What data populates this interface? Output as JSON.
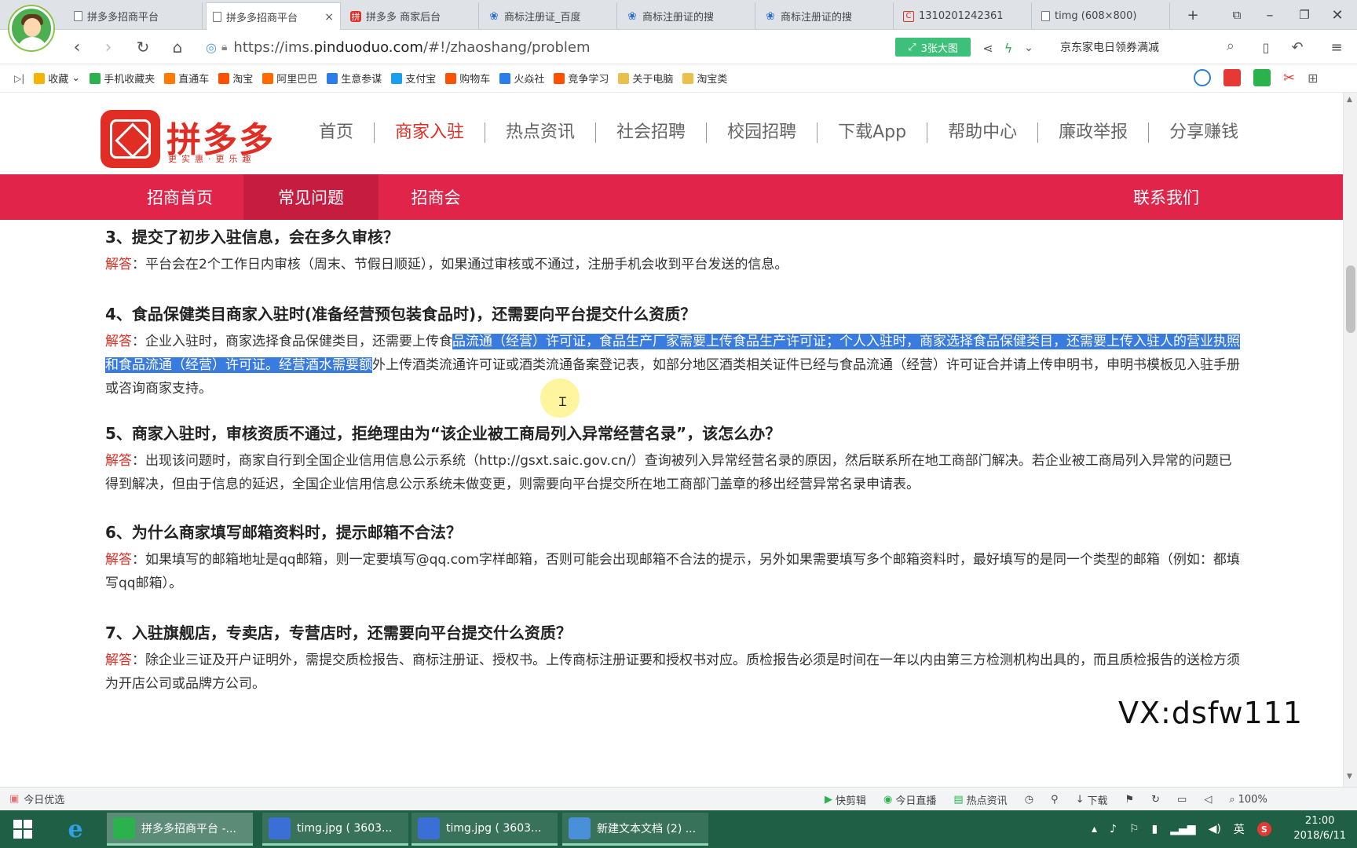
{
  "browser": {
    "tabs": [
      {
        "label": "拼多多招商平台",
        "icon": "doc-icon",
        "active": false
      },
      {
        "label": "拼多多招商平台",
        "icon": "doc-icon",
        "active": true
      },
      {
        "label": "拼多多 商家后台",
        "icon": "pdd-icon",
        "active": false
      },
      {
        "label": "商标注册证_百度",
        "icon": "paw-icon",
        "active": false
      },
      {
        "label": "商标注册证的搜",
        "icon": "paw-icon",
        "active": false
      },
      {
        "label": "商标注册证的搜",
        "icon": "paw-icon",
        "active": false
      },
      {
        "label": "1310201242361",
        "icon": "c-icon",
        "active": false
      },
      {
        "label": "timg (608×800)",
        "icon": "doc-icon",
        "active": false
      }
    ],
    "new_tab": "+",
    "close_glyph": "×",
    "url_prefix": "https://ims.",
    "url_host": "pinduoduo.com",
    "url_path": "/#!/zhaoshang/problem",
    "bigimg_label": "3张大图",
    "search_text": "京东家电日领券满减",
    "bookmarks": [
      {
        "label": "收藏",
        "color": "#f5b400"
      },
      {
        "label": "手机收藏夹",
        "color": "#2bb24c"
      },
      {
        "label": "直通车",
        "color": "#ff7a00"
      },
      {
        "label": "淘宝",
        "color": "#ff5000"
      },
      {
        "label": "阿里巴巴",
        "color": "#ff6a00"
      },
      {
        "label": "生意参谋",
        "color": "#2b7de9"
      },
      {
        "label": "支付宝",
        "color": "#1a9ff0"
      },
      {
        "label": "购物车",
        "color": "#ff5000"
      },
      {
        "label": "火焱社",
        "color": "#2b7de9"
      },
      {
        "label": "竞争学习",
        "color": "#ff5000"
      },
      {
        "label": "关于电脑",
        "color": "#e8c04a"
      },
      {
        "label": "淘宝类",
        "color": "#e8c04a"
      }
    ]
  },
  "site": {
    "logo_name": "拼多多",
    "slogan": "更实惠·更乐趣",
    "top_nav": [
      "首页",
      "商家入驻",
      "热点资讯",
      "社会招聘",
      "校园招聘",
      "下载App",
      "帮助中心",
      "廉政举报",
      "分享赚钱"
    ],
    "top_nav_active": 1,
    "sub_nav": [
      "招商首页",
      "常见问题",
      "招商会"
    ],
    "sub_nav_active": 1,
    "contact": "联系我们"
  },
  "faq": [
    {
      "q": "3、提交了初步入驻信息，会在多久审核？",
      "label": "解答",
      "a": "：平台会在2个工作日内审核（周末、节假日顺延），如果通过审核或不通过，注册手机会收到平台发送的信息。"
    },
    {
      "q": "4、食品保健类目商家入驻时(准备经营预包装食品时)，还需要向平台提交什么资质？",
      "label": "解答",
      "a_pre": "：企业入驻时，商家选择食品保健类目，还需要上传食",
      "a_hl": "品流通（经营）许可证，食品生产厂家需要上传食品生产许可证；个人入驻时，商家选择食品保健类目，还需要上传入驻人的营业执照和食品流通（经营）许可证。经营酒水需要额",
      "a_post": "外上传酒类流通许可证或酒类流通备案登记表，如部分地区酒类相关证件已经与食品流通（经营）许可证合并请上传申明书，申明书模板见入驻手册或咨询商家支持。"
    },
    {
      "q": "5、商家入驻时，审核资质不通过，拒绝理由为“该企业被工商局列入异常经营名录”，该怎么办？",
      "label": "解答",
      "a": "：出现该问题时，商家自行到全国企业信用信息公示系统（http://gsxt.saic.gov.cn/）查询被列入异常经营名录的原因，然后联系所在地工商部门解决。若企业被工商局列入异常的问题已得到解决，但由于信息的延迟，全国企业信用信息公示系统未做变更，则需要向平台提交所在地工商部门盖章的移出经营异常名录申请表。"
    },
    {
      "q": "6、为什么商家填写邮箱资料时，提示邮箱不合法？",
      "label": "解答",
      "a": "：如果填写的邮箱地址是qq邮箱，则一定要填写@qq.com字样邮箱，否则可能会出现邮箱不合法的提示，另外如果需要填写多个邮箱资料时，最好填写的是同一个类型的邮箱（例如：都填写qq邮箱）。"
    },
    {
      "q": "7、入驻旗舰店，专卖店，专营店时，还需要向平台提交什么资质？",
      "label": "解答",
      "a": "：除企业三证及开户证明外，需提交质检报告、商标注册证、授权书。上传商标注册证要和授权书对应。质检报告必须是时间在一年以内由第三方检测机构出具的，而且质检报告的送检方须为开店公司或品牌方公司。"
    }
  ],
  "watermark": "VX:dsfw111",
  "statusbar": {
    "left": "今日优选",
    "items": [
      "快剪辑",
      "今日直播",
      "热点资讯",
      "下载"
    ],
    "zoom": "100%"
  },
  "taskbar": {
    "tasks": [
      {
        "label": "拼多多招商平台 -...",
        "active": true
      },
      {
        "label": "timg.jpg ( 3603...",
        "active": false
      },
      {
        "label": "timg.jpg ( 3603...",
        "active": false
      },
      {
        "label": "新建文本文档 (2) ...",
        "active": false
      }
    ],
    "ime": "英",
    "time": "21:00",
    "date": "2018/6/11"
  }
}
